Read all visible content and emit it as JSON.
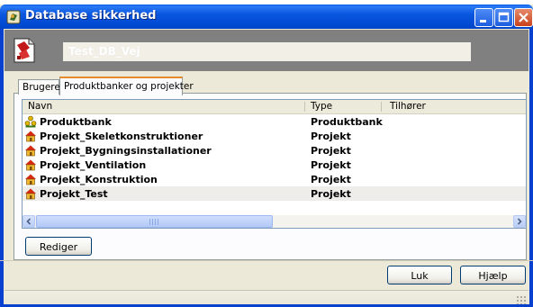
{
  "window": {
    "title": "Database sikkerhed",
    "database_name": "Test_DB_Vej"
  },
  "tabs": [
    {
      "label": "Brugere",
      "active": false
    },
    {
      "label": "Produktbanker og projekter",
      "active": true
    }
  ],
  "list": {
    "columns": [
      "Navn",
      "Type",
      "Tilhører"
    ],
    "rows": [
      {
        "name": "Produktbank",
        "type": "Produktbank",
        "owner": "",
        "icon": "people-icon"
      },
      {
        "name": "Projekt_Skeletkonstruktioner",
        "type": "Projekt",
        "owner": "",
        "icon": "house-icon"
      },
      {
        "name": "Projekt_Bygningsinstallationer",
        "type": "Projekt",
        "owner": "",
        "icon": "house-icon"
      },
      {
        "name": "Projekt_Ventilation",
        "type": "Projekt",
        "owner": "",
        "icon": "house-icon"
      },
      {
        "name": "Projekt_Konstruktion",
        "type": "Projekt",
        "owner": "",
        "icon": "house-icon"
      },
      {
        "name": "Projekt_Test",
        "type": "Projekt",
        "owner": "",
        "icon": "house-icon",
        "selected": true
      }
    ]
  },
  "buttons": {
    "edit": "Rediger",
    "close": "Luk",
    "help": "Hjælp"
  },
  "colors": {
    "titlebar": "#0054e3",
    "header_band": "#808080",
    "active_tab_accent": "#e68b2c",
    "dialog_bg": "#ece9d8"
  }
}
